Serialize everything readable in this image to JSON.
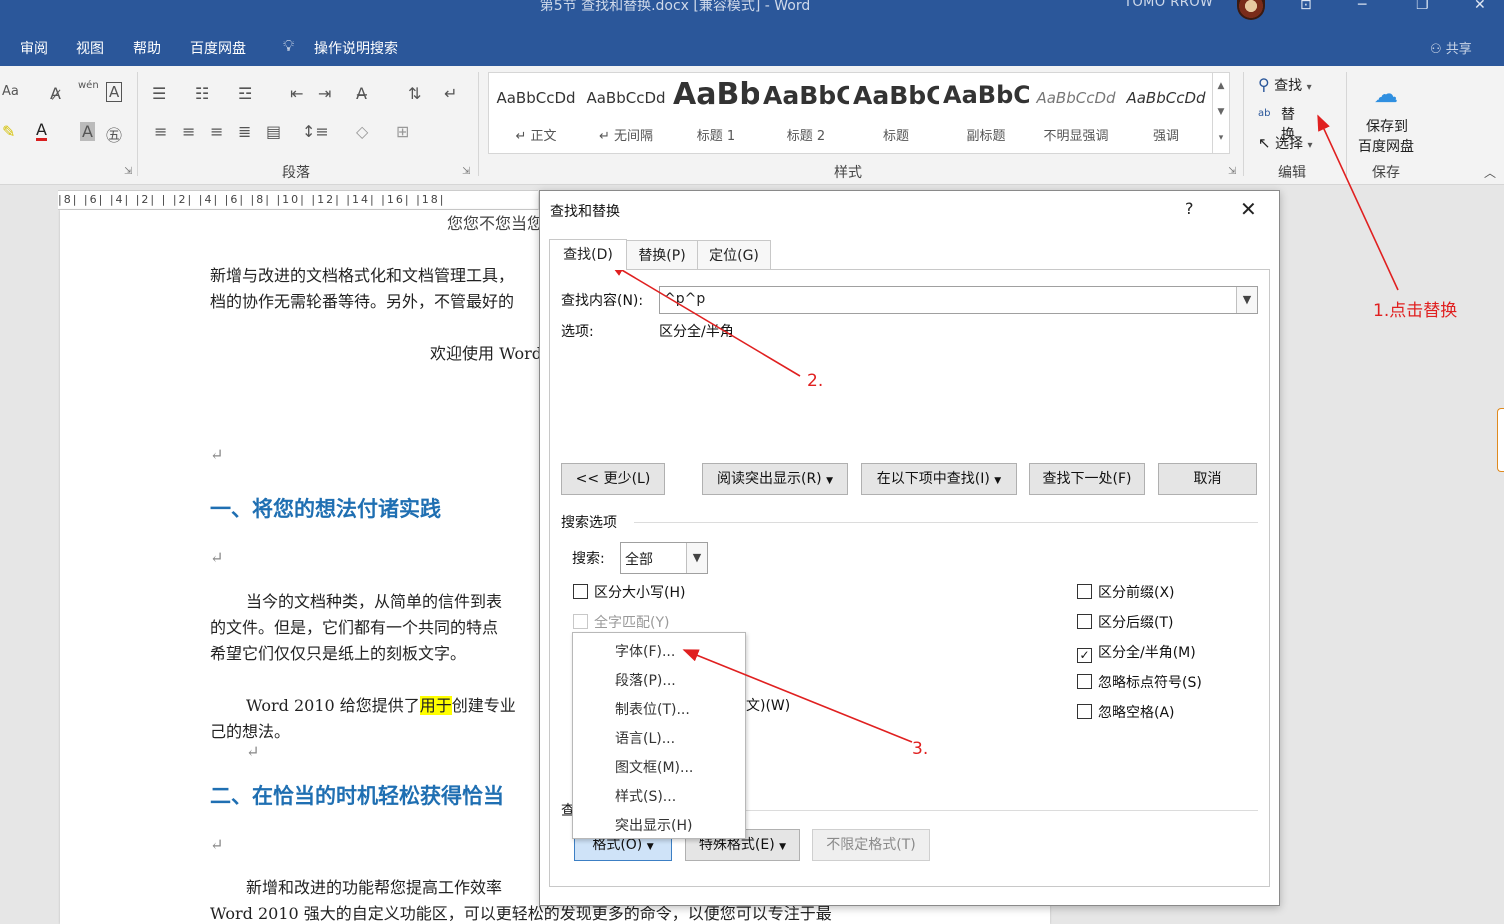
{
  "window": {
    "title": "第5节 查找和替换.docx [兼容模式] - Word",
    "user": "TOMO RROW",
    "restore_icon": "restore-icon",
    "minimize_icon": "minimize-icon",
    "close_icon": "close-icon"
  },
  "menu": {
    "items": [
      "审阅",
      "视图",
      "帮助",
      "百度网盘"
    ],
    "tell_me": "操作说明搜索",
    "share": "共享"
  },
  "ribbon": {
    "paragraph_label": "段落",
    "styles_label": "样式",
    "edit_label": "编辑",
    "save_label": "保存",
    "font_aa": "Aa",
    "wen": "wén",
    "styles": [
      {
        "preview": "AaBbCcDd",
        "name": "↵ 正文"
      },
      {
        "preview": "AaBbCcDd",
        "name": "↵ 无间隔"
      },
      {
        "preview": "AaBb",
        "name": "标题 1"
      },
      {
        "preview": "AaBbC",
        "name": "标题 2"
      },
      {
        "preview": "AaBbC",
        "name": "标题"
      },
      {
        "preview": "AaBbC",
        "name": "副标题"
      },
      {
        "preview": "AaBbCcDd",
        "name": "不明显强调"
      },
      {
        "preview": "AaBbCcDd",
        "name": "强调"
      }
    ],
    "find": "查找",
    "replace": "替换",
    "select": "选择",
    "save_to_line1": "保存到",
    "save_to_line2": "百度网盘"
  },
  "ruler": {
    "text": "|8| |6| |4| |2| | |2| |4| |6| |8| |10| |12| |14| |16| |18|"
  },
  "document": {
    "line_top": "您您不您当您",
    "p1_line1": "新增与改进的文档格式化和文档管理工具，",
    "p1_line2": "档的协作无需轮番等待。另外，不管最好的",
    "welcome": "欢迎使用 Word",
    "heading1": "一、将您的想法付诸实践",
    "p2_line1": "当今的文档种类，从简单的信件到表",
    "p2_line2": "的文件。但是，它们都有一个共同的特点",
    "p2_line3": "希望它们仅仅只是纸上的刻板文字。",
    "p3_before": "Word 2010 给您提供了",
    "p3_highlight": "用于",
    "p3_after": "创建专业",
    "p3_line2": "己的想法。",
    "heading2": "二、在恰当的时机轻松获得恰当",
    "p4_line1": "新增和改进的功能帮您提高工作效率",
    "p4_line2": "Word 2010 强大的自定义功能区，可以更轻松的发现更多的命令，以便您可以专注于最",
    "para_mark": "↵"
  },
  "dialog": {
    "title": "查找和替换",
    "help": "?",
    "close": "✕",
    "tabs": [
      "查找(D)",
      "替换(P)",
      "定位(G)"
    ],
    "find_label": "查找内容(N):",
    "find_value": "^p^p",
    "options_label": "选项:",
    "options_value": "区分全/半角",
    "btn_less": "<< 更少(L)",
    "btn_reading": "阅读突出显示(R)",
    "btn_find_in": "在以下项中查找(I)",
    "btn_find_next": "查找下一处(F)",
    "btn_cancel": "取消",
    "search_options_label": "搜索选项",
    "search_label": "搜索:",
    "search_value": "全部",
    "checks_left": [
      {
        "label": "区分大小写(H)",
        "checked": false,
        "enabled": true
      },
      {
        "label": "全字匹配(Y)",
        "checked": false,
        "enabled": false
      }
    ],
    "partial_text": "文)(W)",
    "checks_right": [
      {
        "label": "区分前缀(X)",
        "checked": false
      },
      {
        "label": "区分后缀(T)",
        "checked": false
      },
      {
        "label": "区分全/半角(M)",
        "checked": true
      },
      {
        "label": "忽略标点符号(S)",
        "checked": false
      },
      {
        "label": "忽略空格(A)",
        "checked": false
      }
    ],
    "find_section_label": "查",
    "btn_format": "格式(O)",
    "btn_special": "特殊格式(E)",
    "btn_no_format": "不限定格式(T)"
  },
  "format_menu": {
    "items": [
      "字体(F)...",
      "段落(P)...",
      "制表位(T)...",
      "语言(L)...",
      "图文框(M)...",
      "样式(S)...",
      "突出显示(H)"
    ]
  },
  "annotations": {
    "a1": "1.点击替换",
    "a2": "2.",
    "a3": "3.",
    "color": "#e02020"
  }
}
